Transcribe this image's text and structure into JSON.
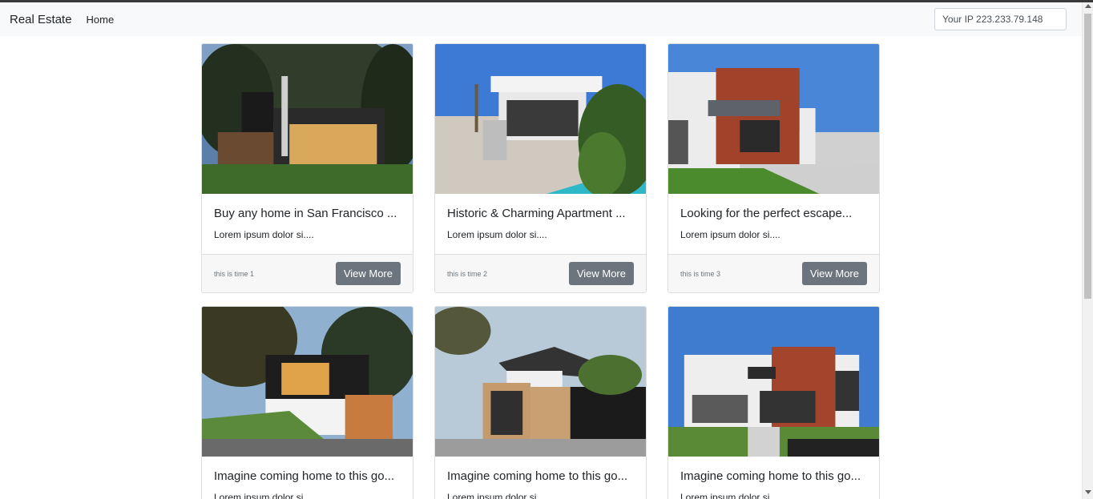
{
  "navbar": {
    "brand": "Real Estate",
    "home_link": "Home",
    "ip_text": "Your IP 223.233.79.148"
  },
  "cards": [
    {
      "title": "Buy any home in San Francisco ...",
      "text": "Lorem ipsum dolor si....",
      "time": "this is time 1",
      "button": "View More"
    },
    {
      "title": "Historic & Charming Apartment ...",
      "text": "Lorem ipsum dolor si....",
      "time": "this is time 2",
      "button": "View More"
    },
    {
      "title": "Looking for the perfect escape...",
      "text": "Lorem ipsum dolor si....",
      "time": "this is time 3",
      "button": "View More"
    },
    {
      "title": "Imagine coming home to this go...",
      "text": "Lorem ipsum dolor si....",
      "time": "",
      "button": ""
    },
    {
      "title": "Imagine coming home to this go...",
      "text": "Lorem ipsum dolor si....",
      "time": "",
      "button": ""
    },
    {
      "title": "Imagine coming home to this go...",
      "text": "Lorem ipsum dolor si....",
      "time": "",
      "button": ""
    }
  ],
  "colors": {
    "navbar_bg": "#f8f9fa",
    "button_bg": "#6c757d",
    "footer_bg": "#f7f7f7"
  }
}
